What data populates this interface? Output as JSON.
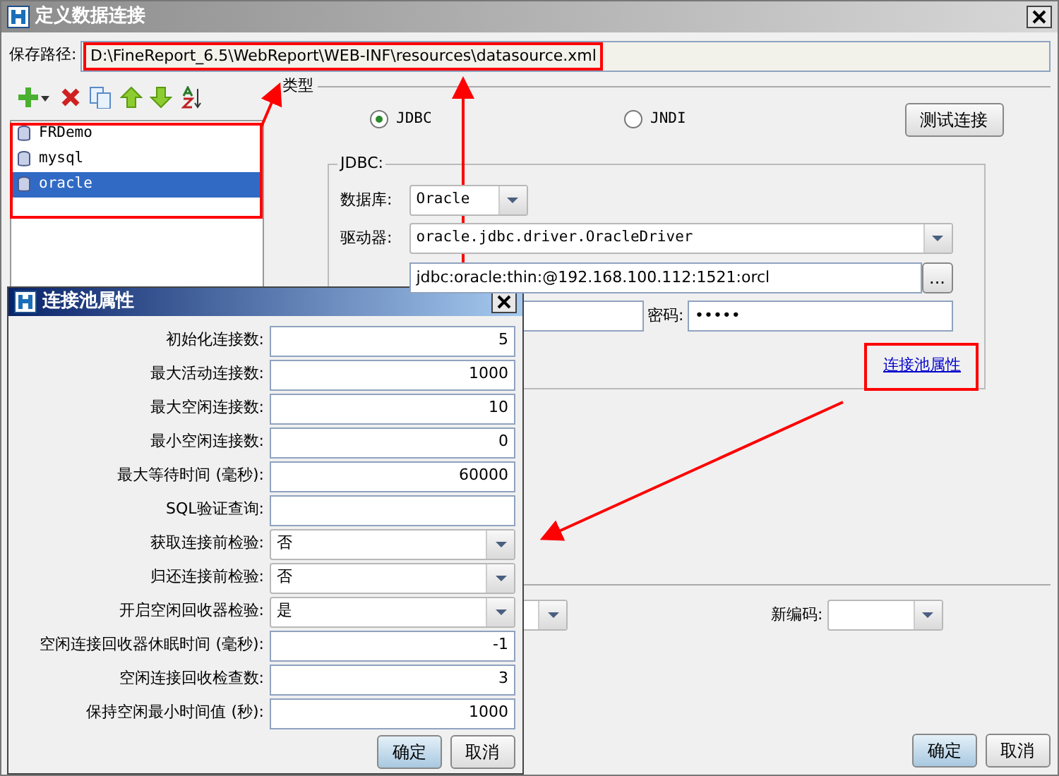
{
  "main_window": {
    "title": "定义数据连接",
    "save_path": {
      "label": "保存路径:",
      "value": "D:\\FineReport_6.5\\WebReport\\WEB-INF\\resources\\datasource.xml"
    },
    "connections": [
      {
        "name": "FRDemo",
        "selected": false
      },
      {
        "name": "mysql",
        "selected": false
      },
      {
        "name": "oracle",
        "selected": true
      }
    ],
    "type_group": {
      "title": "类型",
      "options": [
        {
          "label": "JDBC",
          "selected": true
        },
        {
          "label": "JNDI",
          "selected": false
        }
      ],
      "test_button": "测试连接"
    },
    "jdbc": {
      "title": "JDBC:",
      "database": {
        "label": "数据库:",
        "value": "Oracle"
      },
      "driver": {
        "label": "驱动器:",
        "value": "oracle.jdbc.driver.OracleDriver"
      },
      "url": {
        "value": "jdbc:oracle:thin:@192.168.100.112:1521:orcl",
        "browse": "..."
      },
      "password": {
        "label": "密码:",
        "value": "•••••"
      },
      "pool_link": "连接池属性"
    },
    "new_encoding": {
      "label": "新编码:"
    },
    "buttons": [
      "确定",
      "取消"
    ]
  },
  "pool_dialog": {
    "title": "连接池属性",
    "fields": [
      {
        "kind": "text",
        "label": "初始化连接数:",
        "value": "5"
      },
      {
        "kind": "text",
        "label": "最大活动连接数:",
        "value": "1000"
      },
      {
        "kind": "text",
        "label": "最大空闲连接数:",
        "value": "10"
      },
      {
        "kind": "text",
        "label": "最小空闲连接数:",
        "value": "0"
      },
      {
        "kind": "text",
        "label": "最大等待时间 (毫秒):",
        "value": "60000"
      },
      {
        "kind": "text",
        "label": "SQL验证查询:"
      },
      {
        "kind": "select",
        "label": "获取连接前检验:",
        "value": "否"
      },
      {
        "kind": "select",
        "label": "归还连接前检验:",
        "value": "否"
      },
      {
        "kind": "select",
        "label": "开启空闲回收器检验:",
        "value": "是"
      },
      {
        "kind": "text",
        "label": "空闲连接回收器休眠时间 (毫秒):",
        "value": "-1"
      },
      {
        "kind": "text",
        "label": "空闲连接回收检查数:",
        "value": "3"
      },
      {
        "kind": "text",
        "label": "保持空闲最小时间值 (秒):",
        "value": "1000"
      }
    ],
    "buttons": [
      "确定",
      "取消"
    ]
  }
}
